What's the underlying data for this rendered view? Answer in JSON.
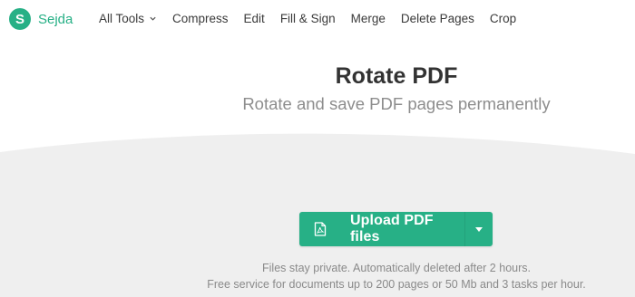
{
  "brand": {
    "badge": "S",
    "name": "Sejda",
    "color": "#27b086"
  },
  "nav": {
    "items": [
      {
        "label": "All Tools",
        "has_dropdown": true
      },
      {
        "label": "Compress"
      },
      {
        "label": "Edit"
      },
      {
        "label": "Fill & Sign"
      },
      {
        "label": "Merge"
      },
      {
        "label": "Delete Pages"
      },
      {
        "label": "Crop"
      }
    ]
  },
  "hero": {
    "title": "Rotate PDF",
    "subtitle": "Rotate and save PDF pages permanently"
  },
  "upload": {
    "label": "Upload PDF files",
    "icon": "pdf-file-icon",
    "dropdown_icon": "caret-down-icon",
    "color": "#27b086"
  },
  "notes": {
    "privacy": "Files stay private. Automatically deleted after 2 hours.",
    "limits": "Free service for documents up to 200 pages or 50 Mb and 3 tasks per hour."
  },
  "colors": {
    "drop_area": "#efefef",
    "accent": "#27b086"
  }
}
